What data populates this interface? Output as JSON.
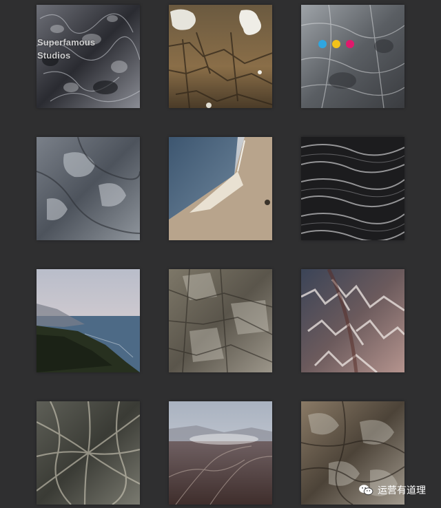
{
  "brand": {
    "line1": "Superfamous",
    "line2": "Studios"
  },
  "color_dots": [
    {
      "name": "cyan-dot",
      "color": "#2fa6e0"
    },
    {
      "name": "yellow-dot",
      "color": "#f2c21a"
    },
    {
      "name": "magenta-dot",
      "color": "#e0196c"
    }
  ],
  "gallery": {
    "tiles": [
      {
        "name": "tile-crystal-rock",
        "icon": "image-thumbnail"
      },
      {
        "name": "tile-aerial-snow-terrain",
        "icon": "image-thumbnail"
      },
      {
        "name": "tile-gray-rock-surface",
        "icon": "image-thumbnail"
      },
      {
        "name": "tile-blue-gray-rock",
        "icon": "image-thumbnail"
      },
      {
        "name": "tile-aerial-coastline",
        "icon": "image-thumbnail"
      },
      {
        "name": "tile-dark-ridges",
        "icon": "image-thumbnail"
      },
      {
        "name": "tile-coastal-cliffs",
        "icon": "image-thumbnail"
      },
      {
        "name": "tile-cliff-face",
        "icon": "image-thumbnail"
      },
      {
        "name": "tile-snowy-mountain-ridges",
        "icon": "image-thumbnail"
      },
      {
        "name": "tile-root-rock-texture",
        "icon": "image-thumbnail"
      },
      {
        "name": "tile-misty-valley",
        "icon": "image-thumbnail"
      },
      {
        "name": "tile-rough-rock-texture",
        "icon": "image-thumbnail"
      }
    ]
  },
  "watermark": {
    "text": "运营有道理",
    "icon": "wechat-icon"
  }
}
